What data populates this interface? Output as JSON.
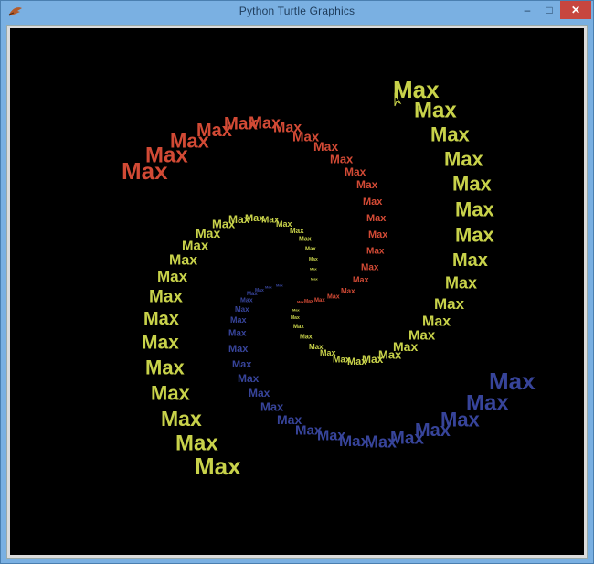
{
  "window": {
    "title": "Python Turtle Graphics",
    "controls": {
      "minimize": "–",
      "maximize": "□",
      "close": "✕"
    },
    "app_icon": "turtle-feather-icon"
  },
  "canvas": {
    "background": "#000000",
    "word": "Max",
    "colors": {
      "red": "#d24a35",
      "yellow": "#c8d24a",
      "blue": "#37449a"
    },
    "cursor_icon": "turtle-arrow-cursor-icon"
  }
}
